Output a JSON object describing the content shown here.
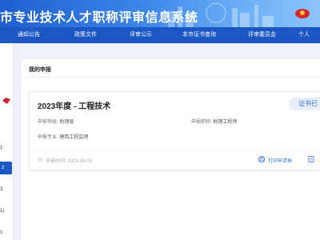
{
  "header": {
    "site_title": "市专业技术人才职称评审信息系统"
  },
  "nav": [
    {
      "label": "通知公告"
    },
    {
      "label": "政策文件"
    },
    {
      "label": "评审公示"
    },
    {
      "label": "本市证书查询"
    },
    {
      "label": "评审委员会"
    },
    {
      "label": "个人"
    }
  ],
  "sidebar": {
    "items": [
      "1",
      "2",
      "3",
      "1)",
      "1"
    ]
  },
  "main": {
    "title": "我的申报",
    "card": {
      "title": "2023年度 - 工程技术",
      "status": "证书已",
      "level_label": "申报等级:",
      "level_value": "助理级",
      "position_label": "申报职称:",
      "position_value": "助理工程师",
      "major_label": "申报专业:",
      "major_value": "建筑工程监理",
      "time_label": "申报时间:",
      "time_value": "2023-08-05",
      "print_label": "打印申请表"
    }
  },
  "colors": {
    "primary": "#1c57c4",
    "badge_bg": "#e6eefb",
    "badge_text": "#3b73d1",
    "page_bg": "#eef2f8"
  }
}
